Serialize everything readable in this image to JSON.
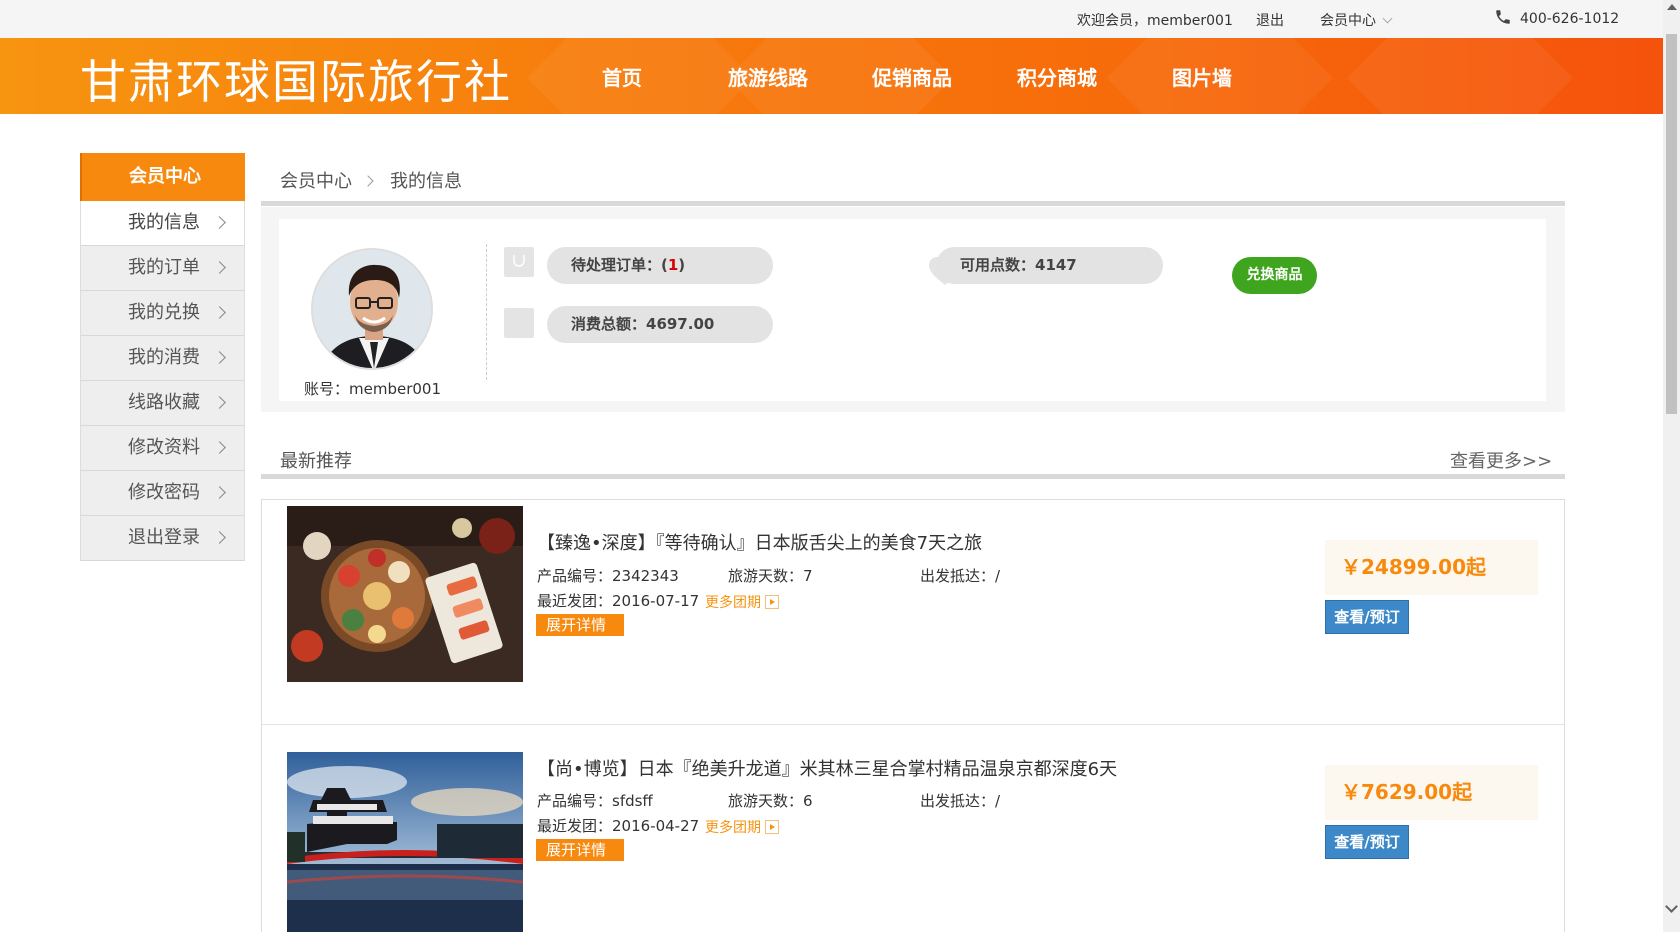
{
  "topbar": {
    "welcome": "欢迎会员，member001",
    "logout": "退出",
    "member_center": "会员中心",
    "phone": "400-626-1012"
  },
  "header": {
    "logo": "甘肃环球国际旅行社",
    "nav": [
      "首页",
      "旅游线路",
      "促销商品",
      "积分商城",
      "图片墙"
    ]
  },
  "sidebar": {
    "title": "会员中心",
    "items": [
      {
        "label": "我的信息",
        "active": true
      },
      {
        "label": "我的订单"
      },
      {
        "label": "我的兑换"
      },
      {
        "label": "我的消费"
      },
      {
        "label": "线路收藏"
      },
      {
        "label": "修改资料"
      },
      {
        "label": "修改密码"
      },
      {
        "label": "退出登录"
      }
    ]
  },
  "breadcrumb": [
    "会员中心",
    "我的信息"
  ],
  "profile": {
    "account": "账号：member001",
    "pending_label": "待处理订单：(",
    "pending_count": "1",
    "pending_close": ")",
    "points": "可用点数：4147",
    "exchange_button": "兑换商品",
    "total_spent": "消费总额：4697.00"
  },
  "recommend": {
    "title": "最新推荐",
    "more": "查看更多>>",
    "products": [
      {
        "title": "【臻逸•深度】『等待确认』日本版舌尖上的美食7天之旅",
        "code": "产品编号：2342343",
        "days": "旅游天数：7",
        "depart": "出发抵达：/",
        "latest": "最近发团：2016-07-17",
        "more_groups": "更多团期",
        "expand": "展开详情",
        "price": "￥24899.00起",
        "book": "查看/预订"
      },
      {
        "title": "【尚•博览】日本『绝美升龙道』米其林三星合掌村精品温泉京都深度6天",
        "code": "产品编号：sfdsff",
        "days": "旅游天数：6",
        "depart": "出发抵达：/",
        "latest": "最近发团：2016-04-27",
        "more_groups": "更多团期",
        "expand": "展开详情",
        "price": "￥7629.00起",
        "book": "查看/预订"
      }
    ]
  }
}
